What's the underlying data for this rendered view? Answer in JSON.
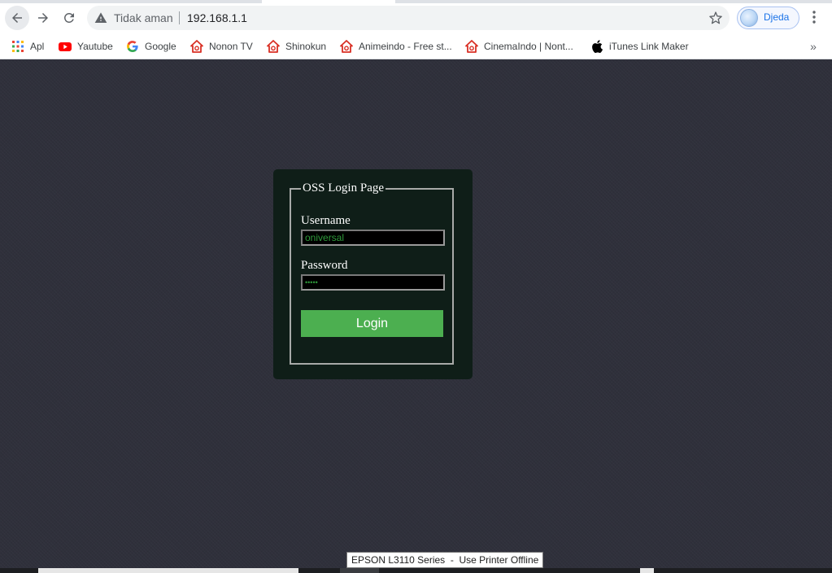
{
  "browser": {
    "security_text": "Tidak aman",
    "url": "192.168.1.1",
    "profile_name": "Djeda"
  },
  "bookmarks": [
    {
      "label": "Apl",
      "icon": "apps-grid-icon"
    },
    {
      "label": "Yautube",
      "icon": "youtube-icon"
    },
    {
      "label": "Google",
      "icon": "google-icon"
    },
    {
      "label": "Nonon TV",
      "icon": "red-house-icon"
    },
    {
      "label": "Shinokun",
      "icon": "red-house-icon"
    },
    {
      "label": "Animeindo - Free st...",
      "icon": "red-house-icon"
    },
    {
      "label": "CinemaIndo | Nont...",
      "icon": "red-house-icon"
    },
    {
      "label": "iTunes Link Maker",
      "icon": "apple-icon"
    }
  ],
  "login": {
    "legend": "OSS Login Page",
    "username_label": "Username",
    "username_value": "oniversal",
    "password_label": "Password",
    "password_value": "•••••",
    "button_label": "Login"
  },
  "tooltip": {
    "text": "EPSON L3110 Series  -  Use Printer Offline"
  },
  "colors": {
    "page_background": "#2f303b",
    "panel_background": "#0f1e18",
    "button_green": "#4caf50",
    "input_text_green": "#2f9a3b",
    "link_blue": "#1a73e8"
  }
}
